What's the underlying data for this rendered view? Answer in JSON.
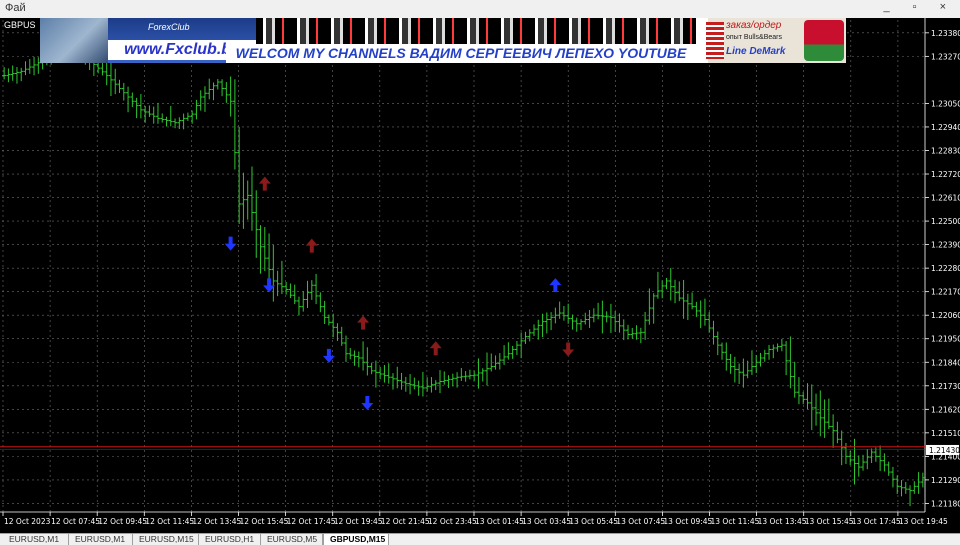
{
  "menu": {
    "first_item": "Фай",
    "controls": "_ ▫ ×"
  },
  "chart_window": {
    "symbol_label": "GBPUS"
  },
  "banner": {
    "fx_top": "ForexClub",
    "fx_url": "www.Fxclub.by",
    "title": "WELCOM MY CHANNELS ВАДИМ СЕРГЕЕВИЧ ЛЕПЕХО YOUTUBE",
    "right_line1": "заказ/ордер",
    "right_line2": "опыт Bulls&Bears",
    "right_line3": "Line DeMark"
  },
  "chart_data": {
    "type": "bar",
    "y_ticks": [
      "1.23380",
      "1.23270",
      "1.23050",
      "1.22940",
      "1.22830",
      "1.22720",
      "1.22610",
      "1.22500",
      "1.22390",
      "1.22280",
      "1.22170",
      "1.22060",
      "1.21950",
      "1.21840",
      "1.21730",
      "1.21620",
      "1.21510",
      "1.21400",
      "1.21290",
      "1.21180"
    ],
    "ylim": [
      1.2114,
      1.2344
    ],
    "x_ticks": [
      "12 Oct 2023",
      "12 Oct 07:45",
      "12 Oct 09:45",
      "12 Oct 11:45",
      "12 Oct 13:45",
      "12 Oct 15:45",
      "12 Oct 17:45",
      "12 Oct 19:45",
      "12 Oct 21:45",
      "12 Oct 23:45",
      "13 Oct 01:45",
      "13 Oct 03:45",
      "13 Oct 05:45",
      "13 Oct 07:45",
      "13 Oct 09:45",
      "13 Oct 11:45",
      "13 Oct 13:45",
      "13 Oct 15:45",
      "13 Oct 17:45",
      "13 Oct 19:45"
    ],
    "current_price": "1.21430",
    "current_price_value": 1.2143,
    "price_line_value": 1.21445,
    "bar_color": "#2ec82e",
    "price_anchors": [
      [
        0,
        1.2318
      ],
      [
        4,
        1.232
      ],
      [
        8,
        1.2324
      ],
      [
        12,
        1.2328
      ],
      [
        16,
        1.2334
      ],
      [
        20,
        1.2325
      ],
      [
        24,
        1.2318
      ],
      [
        28,
        1.231
      ],
      [
        32,
        1.2302
      ],
      [
        36,
        1.2298
      ],
      [
        40,
        1.2296
      ],
      [
        44,
        1.23
      ],
      [
        46,
        1.2308
      ],
      [
        50,
        1.2315
      ],
      [
        53,
        1.2306
      ],
      [
        55,
        1.2258
      ],
      [
        57,
        1.2262
      ],
      [
        60,
        1.2238
      ],
      [
        63,
        1.2222
      ],
      [
        66,
        1.2218
      ],
      [
        69,
        1.221
      ],
      [
        72,
        1.222
      ],
      [
        75,
        1.2205
      ],
      [
        78,
        1.2198
      ],
      [
        80,
        1.2188
      ],
      [
        83,
        1.2186
      ],
      [
        86,
        1.218
      ],
      [
        90,
        1.2177
      ],
      [
        94,
        1.2174
      ],
      [
        98,
        1.2172
      ],
      [
        102,
        1.2175
      ],
      [
        106,
        1.2177
      ],
      [
        110,
        1.2178
      ],
      [
        114,
        1.2182
      ],
      [
        118,
        1.2188
      ],
      [
        122,
        1.2196
      ],
      [
        126,
        1.2203
      ],
      [
        130,
        1.2207
      ],
      [
        134,
        1.2202
      ],
      [
        138,
        1.2206
      ],
      [
        142,
        1.2205
      ],
      [
        146,
        1.2197
      ],
      [
        149,
        1.2198
      ],
      [
        152,
        1.2215
      ],
      [
        155,
        1.2222
      ],
      [
        158,
        1.2214
      ],
      [
        161,
        1.221
      ],
      [
        164,
        1.2204
      ],
      [
        167,
        1.2192
      ],
      [
        170,
        1.2182
      ],
      [
        173,
        1.2178
      ],
      [
        176,
        1.2184
      ],
      [
        179,
        1.219
      ],
      [
        182,
        1.2192
      ],
      [
        185,
        1.217
      ],
      [
        188,
        1.2165
      ],
      [
        191,
        1.2158
      ],
      [
        194,
        1.2152
      ],
      [
        197,
        1.214
      ],
      [
        200,
        1.2135
      ],
      [
        203,
        1.2142
      ],
      [
        206,
        1.2136
      ],
      [
        209,
        1.2126
      ],
      [
        212,
        1.2124
      ],
      [
        215,
        1.213
      ]
    ],
    "bar_count": 216,
    "arrows": [
      {
        "dir": "down",
        "color": "#1e36ff",
        "bar": 53,
        "price": 1.2239
      },
      {
        "dir": "down",
        "color": "#1e36ff",
        "bar": 62,
        "price": 1.22195
      },
      {
        "dir": "down",
        "color": "#1e36ff",
        "bar": 76,
        "price": 1.21865
      },
      {
        "dir": "down",
        "color": "#1e36ff",
        "bar": 85,
        "price": 1.21645
      },
      {
        "dir": "down",
        "color": "#8b1a1a",
        "bar": 132,
        "price": 1.21895
      },
      {
        "dir": "up",
        "color": "#8b1a1a",
        "bar": 61,
        "price": 1.2268
      },
      {
        "dir": "up",
        "color": "#8b1a1a",
        "bar": 72,
        "price": 1.2239
      },
      {
        "dir": "up",
        "color": "#8b1a1a",
        "bar": 84,
        "price": 1.2203
      },
      {
        "dir": "up",
        "color": "#8b1a1a",
        "bar": 101,
        "price": 1.2191
      },
      {
        "dir": "up",
        "color": "#1e36ff",
        "bar": 129,
        "price": 1.22205
      }
    ]
  },
  "tabs": [
    {
      "label": "EURUSD,M1",
      "active": false
    },
    {
      "label": "EURUSD,M1",
      "active": false
    },
    {
      "label": "EURUSD,M15",
      "active": false
    },
    {
      "label": "EURUSD,H1",
      "active": false
    },
    {
      "label": "EURUSD,M5",
      "active": false
    },
    {
      "label": "GBPUSD,M15",
      "active": true
    }
  ]
}
